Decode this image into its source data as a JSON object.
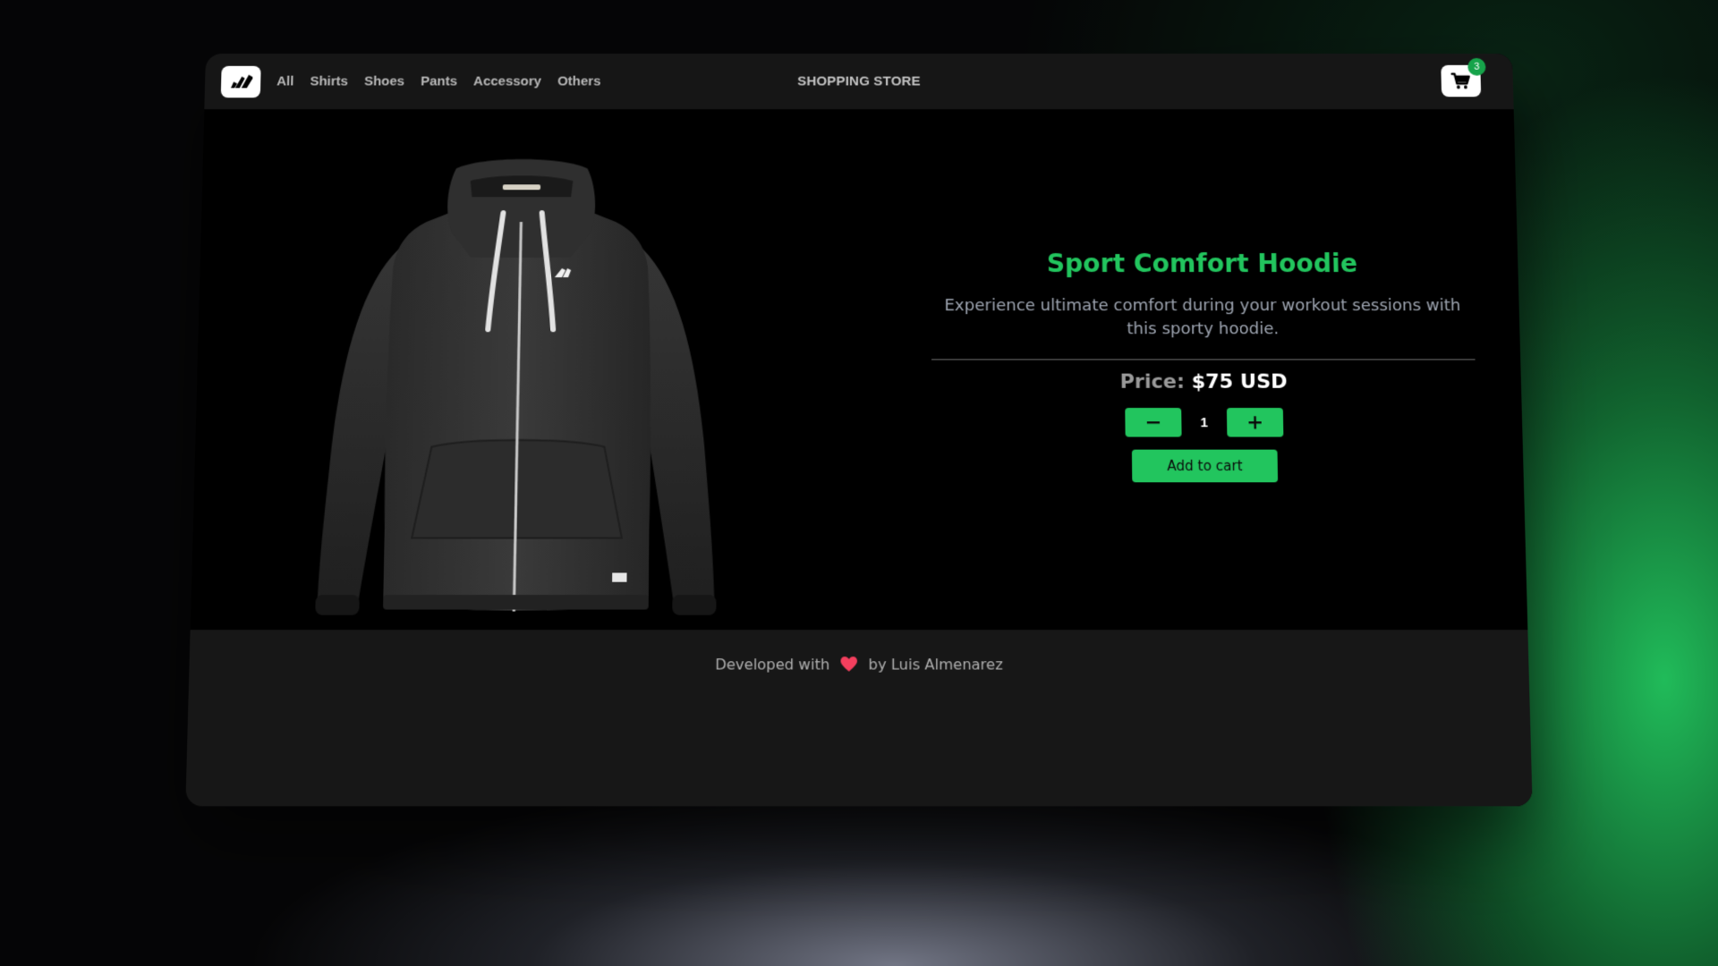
{
  "navbar": {
    "logo_icon": "adidas-logo-icon",
    "links": [
      "All",
      "Shirts",
      "Shoes",
      "Pants",
      "Accessory",
      "Others"
    ],
    "store_title": "SHOPPING STORE",
    "cart": {
      "icon": "shopping-cart-icon",
      "count": "3"
    }
  },
  "product": {
    "image_alt": "Dark gray zip-up hoodie",
    "title": "Sport Comfort Hoodie",
    "description": "Experience ultimate comfort during your workout sessions with this sporty hoodie.",
    "price_label": "Price:",
    "price_value": "$75 USD",
    "quantity": "1",
    "decrement_icon": "minus-icon",
    "increment_icon": "plus-icon",
    "add_to_cart_label": "Add to cart"
  },
  "footer": {
    "text_before": "Developed with",
    "heart_icon": "heart-icon",
    "text_after": "by Luis Almenarez"
  },
  "colors": {
    "accent_green": "#22c55e",
    "badge_green": "#16a34a",
    "navbar_bg": "#161616",
    "footer_bg": "#171717",
    "heart_pink": "#f43f5e"
  }
}
